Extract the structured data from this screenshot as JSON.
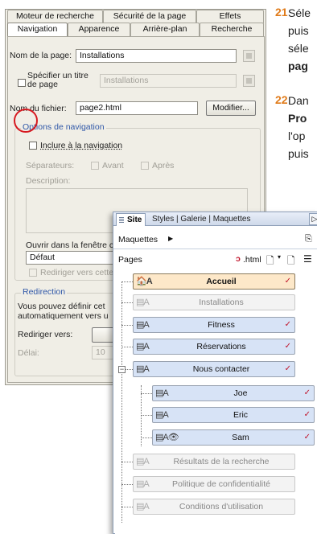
{
  "dialog": {
    "tabs_row1": [
      "Moteur de recherche",
      "Sécurité de la page",
      "Effets"
    ],
    "tabs_row2": [
      "Navigation",
      "Apparence",
      "Arrière-plan",
      "Recherche"
    ],
    "page_name_label": "Nom de la page:",
    "page_name_value": "Installations",
    "specify_title_label_1": "Spécifier un titre",
    "specify_title_label_2": "de page",
    "title_value": "Installations",
    "filename_label": "Nom du fichier:",
    "filename_value": "page2.html",
    "modify_button": "Modifier...",
    "nav_group_title": "Options de navigation",
    "include_nav_label": "Inclure à la navigation",
    "separators_label": "Séparateurs:",
    "before_label": "Avant",
    "after_label": "Après",
    "description_label": "Description:",
    "open_in_label": "Ouvrir dans la fenêtre c",
    "open_in_value": "Défaut",
    "redirect_check_label": "Rediriger vers cette",
    "redirect_group_title": "Redirection",
    "redirect_text_1": "Vous pouvez définir cet",
    "redirect_text_2": "automatiquement vers u",
    "redirect_to_label": "Rediriger vers:",
    "delay_label": "Délai:",
    "delay_value": "10"
  },
  "instructions": [
    {
      "num": "21",
      "lines": [
        "Séle",
        "puis",
        "séle",
        "pag"
      ]
    },
    {
      "num": "22",
      "lines": [
        "Dan",
        "Pro",
        "l'op",
        "puis"
      ]
    }
  ],
  "site_panel": {
    "active_tab": "Site",
    "other_tabs": "Styles | Galerie | Maquettes",
    "arrow": "▷",
    "masters_label": "Maquettes",
    "pages_label": "Pages",
    "html_label": ".html",
    "pages": [
      {
        "name": "Accueil",
        "type": "home",
        "checked": true
      },
      {
        "name": "Installations",
        "type": "hidden",
        "checked": false
      },
      {
        "name": "Fitness",
        "type": "normal",
        "checked": true
      },
      {
        "name": "Réservations",
        "type": "normal",
        "checked": true
      },
      {
        "name": "Nous contacter",
        "type": "normal",
        "checked": true
      },
      {
        "name": "Joe",
        "type": "normal",
        "checked": true
      },
      {
        "name": "Eric",
        "type": "normal",
        "checked": true
      },
      {
        "name": "Sam",
        "type": "normal",
        "checked": true
      },
      {
        "name": "Résultats de la recherche",
        "type": "hidden",
        "checked": false
      },
      {
        "name": "Politique de confidentialité",
        "type": "hidden",
        "checked": false
      },
      {
        "name": "Conditions d'utilisation",
        "type": "hidden",
        "checked": false
      }
    ]
  },
  "colors": {
    "accent_red": "#d71920",
    "step_orange": "#e07b1a",
    "node_blue": "#d7e3f6",
    "home_fill": "#fde8c9"
  }
}
